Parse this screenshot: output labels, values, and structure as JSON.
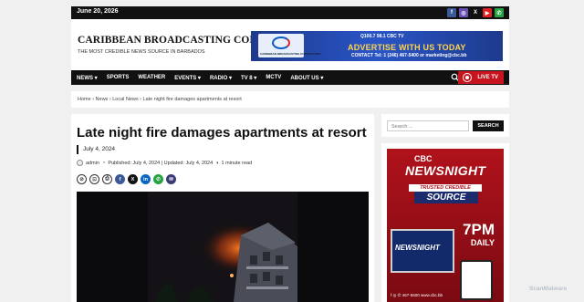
{
  "topbar": {
    "date": "June 20, 2026",
    "social": [
      {
        "icon": "facebook-icon",
        "glyph": "f",
        "color": "#3b5998"
      },
      {
        "icon": "instagram-icon",
        "glyph": "◎",
        "color": "#6a4fb5"
      },
      {
        "icon": "x-icon",
        "glyph": "X",
        "color": "#111111"
      },
      {
        "icon": "youtube-icon",
        "glyph": "▶",
        "color": "#e02020"
      },
      {
        "icon": "whatsapp-icon",
        "glyph": "✆",
        "color": "#25a244"
      }
    ]
  },
  "header": {
    "brand": "CARIBBEAN BROADCASTING CORPORATION",
    "tagline": "THE MOST CREDIBLE NEWS SOURCE IN BARBADOS"
  },
  "ad": {
    "logo_text": "CARIBBEAN BROADCASTING CORPORATION",
    "brands": "Q100.7  98.1  CBC TV",
    "headline": "ADVERTISE WITH US TODAY",
    "contact": "CONTACT Tel: 1 (246) 467-5400 or marketing@cbc.bb"
  },
  "nav": {
    "items": [
      "NEWS ▾",
      "SPORTS",
      "WEATHER",
      "EVENTS ▾",
      "RADIO ▾",
      "TV 8 ▾",
      "MCTV",
      "ABOUT US ▾"
    ],
    "live": "LIVE TV"
  },
  "breadcrumb": "Home  ›  News  ›  Local News  ›  Late night fire damages apartments at resort",
  "article": {
    "title": "Late night fire damages apartments at resort",
    "date": "July 4, 2024",
    "author": "admin",
    "published": "Published: July 4, 2024 | Updated: July 4, 2024",
    "read_time": "1 minute read"
  },
  "share": [
    {
      "icon": "link-icon",
      "glyph": "⊘",
      "style": "out"
    },
    {
      "icon": "bookmark-icon",
      "glyph": "⊡",
      "style": "out"
    },
    {
      "icon": "print-icon",
      "glyph": "⎙",
      "style": "out"
    },
    {
      "icon": "facebook-icon",
      "glyph": "f",
      "color": "#3b5998"
    },
    {
      "icon": "x-icon",
      "glyph": "X",
      "color": "#111111"
    },
    {
      "icon": "linkedin-icon",
      "glyph": "in",
      "color": "#0a66c2"
    },
    {
      "icon": "whatsapp-icon",
      "glyph": "✆",
      "color": "#25a244"
    },
    {
      "icon": "email-icon",
      "glyph": "✉",
      "color": "#3b3b7a"
    }
  ],
  "sidebar": {
    "search_placeholder": "Search ...",
    "search_button": "SEARCH",
    "promo": {
      "cbc": "CBC",
      "newsnight": "NEWSNIGHT",
      "trusted": "TRUSTED CREDIBLE",
      "source": "SOURCE",
      "time": "7PM",
      "daily": "DAILY",
      "tv_label": "NEWSNIGHT",
      "bottom": "f ◎ ✆ 467-5500   www.cbc.bb"
    }
  },
  "watermark": "ScanMalware"
}
